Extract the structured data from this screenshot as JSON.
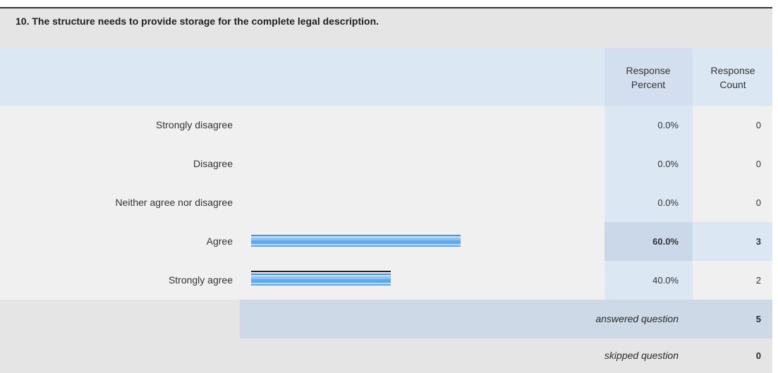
{
  "question": {
    "title": "10. The structure needs to provide storage for the complete legal description."
  },
  "columns": {
    "percent_header": "Response\nPercent",
    "count_header": "Response\nCount"
  },
  "rows": [
    {
      "label": "Strongly disagree",
      "percent": "0.0%",
      "count": "0",
      "fraction": 0.0
    },
    {
      "label": "Disagree",
      "percent": "0.0%",
      "count": "0",
      "fraction": 0.0
    },
    {
      "label": "Neither agree nor disagree",
      "percent": "0.0%",
      "count": "0",
      "fraction": 0.0
    },
    {
      "label": "Agree",
      "percent": "60.0%",
      "count": "3",
      "fraction": 0.6
    },
    {
      "label": "Strongly agree",
      "percent": "40.0%",
      "count": "2",
      "fraction": 0.4
    }
  ],
  "summary": {
    "answered_label": "answered question",
    "answered_value": "5",
    "skipped_label": "skipped question",
    "skipped_value": "0"
  },
  "colors": {
    "bar_primary": "#5fa8ee",
    "header_background": "#dce7f4",
    "title_background": "#e5e5e5"
  }
}
